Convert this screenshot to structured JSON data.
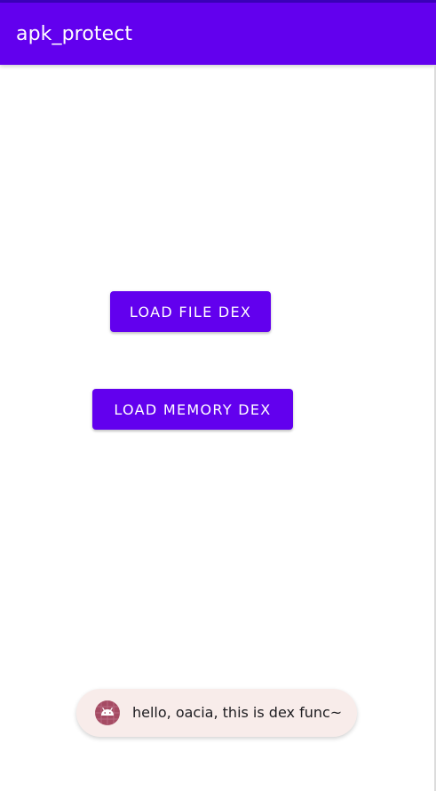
{
  "app_bar": {
    "title": "apk_protect",
    "color": "#6200ee"
  },
  "buttons": {
    "load_file_dex": "LOAD FILE DEX",
    "load_memory_dex": "LOAD MEMORY DEX",
    "color": "#6200ee"
  },
  "toast": {
    "icon": "android-robot-icon",
    "icon_color": "#a54b63",
    "message": "hello, oacia, this is dex func~"
  }
}
